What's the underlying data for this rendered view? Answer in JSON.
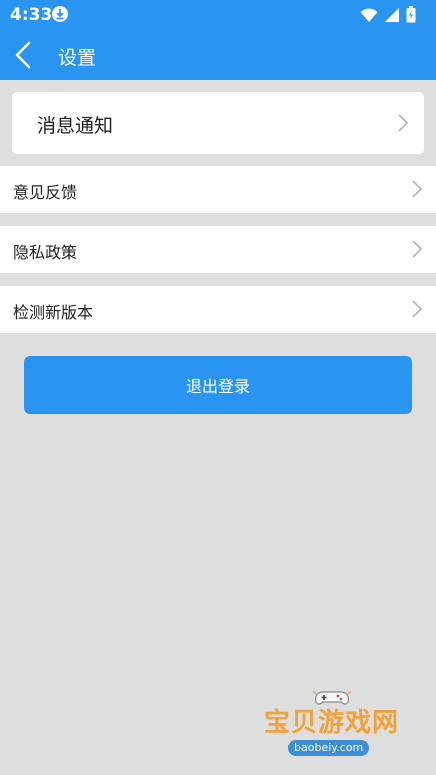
{
  "status_bar": {
    "time": "4:33"
  },
  "app_bar": {
    "title": "设置"
  },
  "settings": {
    "notification_label": "消息通知",
    "feedback_label": "意见反馈",
    "privacy_label": "隐私政策",
    "update_label": "检测新版本"
  },
  "logout_label": "退出登录",
  "watermark": {
    "text": "宝贝游戏网",
    "url": "baobeiy.com"
  },
  "colors": {
    "primary": "#2a95f1",
    "background": "#dedede",
    "watermark_orange": "#f2a23b"
  }
}
